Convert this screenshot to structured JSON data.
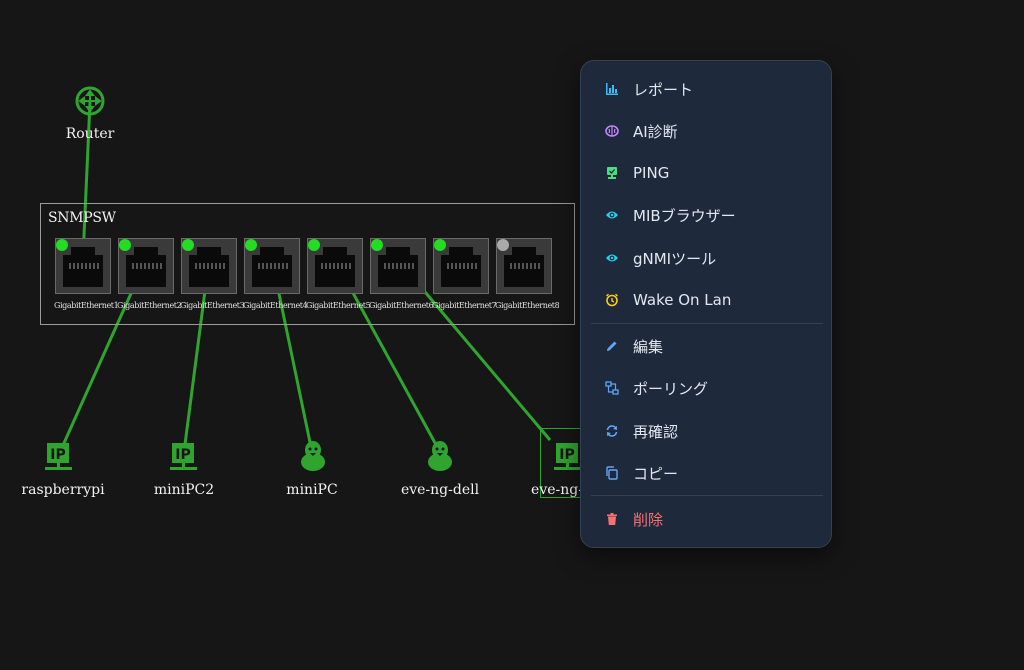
{
  "topology": {
    "router": {
      "label": "Router"
    },
    "switch": {
      "name": "SNMPSW",
      "ports": [
        {
          "label": "GigabitEthernet1",
          "status": "up"
        },
        {
          "label": "GigabitEthernet2",
          "status": "up"
        },
        {
          "label": "GigabitEthernet3",
          "status": "up"
        },
        {
          "label": "GigabitEthernet4",
          "status": "up"
        },
        {
          "label": "GigabitEthernet5",
          "status": "up"
        },
        {
          "label": "GigabitEthernet6",
          "status": "up"
        },
        {
          "label": "GigabitEthernet7",
          "status": "up"
        },
        {
          "label": "GigabitEthernet8",
          "status": "down"
        }
      ]
    },
    "hosts": [
      {
        "label": "raspberrypi",
        "icon": "ip-host-icon"
      },
      {
        "label": "miniPC2",
        "icon": "ip-host-icon"
      },
      {
        "label": "miniPC",
        "icon": "linux-icon"
      },
      {
        "label": "eve-ng-dell",
        "icon": "linux-icon"
      },
      {
        "label": "eve-ng-",
        "icon": "ip-host-icon"
      }
    ],
    "colors": {
      "link": "#2fa52f",
      "led_up": "#22dd22",
      "led_down": "#aaaaaa"
    }
  },
  "context_menu": {
    "items": [
      {
        "label": "レポート",
        "icon": "chart-icon",
        "color": "#38bdf8"
      },
      {
        "label": "AI診断",
        "icon": "brain-icon",
        "color": "#c084fc"
      },
      {
        "label": "PING",
        "icon": "monitor-icon",
        "color": "#4ade80"
      },
      {
        "label": "MIBブラウザー",
        "icon": "eye-icon",
        "color": "#22d3ee"
      },
      {
        "label": "gNMIツール",
        "icon": "eye-icon",
        "color": "#22d3ee"
      },
      {
        "label": "Wake On Lan",
        "icon": "alarm-icon",
        "color": "#facc15"
      },
      {
        "label": "編集",
        "icon": "pencil-icon",
        "color": "#60a5fa"
      },
      {
        "label": "ポーリング",
        "icon": "polling-icon",
        "color": "#60a5fa"
      },
      {
        "label": "再確認",
        "icon": "refresh-icon",
        "color": "#60a5fa"
      },
      {
        "label": "コピー",
        "icon": "copy-icon",
        "color": "#60a5fa"
      },
      {
        "label": "削除",
        "icon": "trash-icon",
        "color": "#f87171"
      }
    ]
  }
}
